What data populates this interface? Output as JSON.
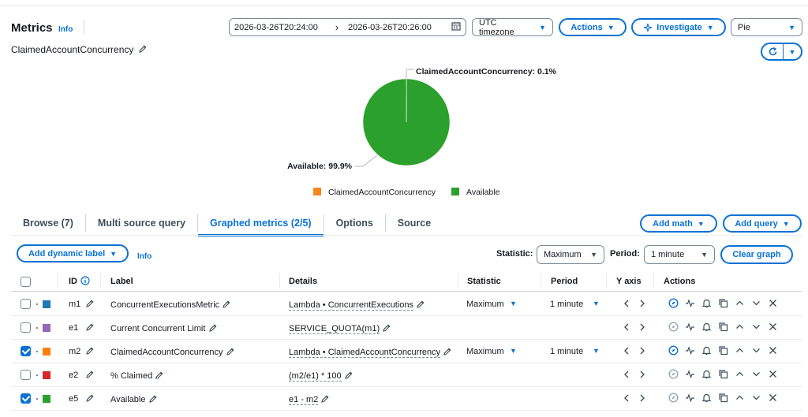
{
  "header": {
    "title": "Metrics",
    "info": "Info",
    "graph_name": "ClaimedAccountConcurrency",
    "time_start": "2026-03-26T20:24:00",
    "time_arrow": "›",
    "time_end": "2026-03-26T20:26:00",
    "timezone": "UTC timezone",
    "actions": "Actions",
    "investigate": "Investigate",
    "graph_type": "Pie"
  },
  "chart_data": {
    "type": "pie",
    "slices": [
      {
        "label": "ClaimedAccountConcurrency",
        "value": 0.1,
        "color": "#f7861e",
        "callout": "ClaimedAccountConcurrency: 0.1%"
      },
      {
        "label": "Available",
        "value": 99.9,
        "color": "#2ca02c",
        "callout": "Available: 99.9%"
      }
    ],
    "legend": [
      "ClaimedAccountConcurrency",
      "Available"
    ],
    "legend_placement": "bottom"
  },
  "tabs": [
    {
      "label": "Browse (7)",
      "active": false
    },
    {
      "label": "Multi source query",
      "active": false
    },
    {
      "label": "Graphed metrics (2/5)",
      "active": true
    },
    {
      "label": "Options",
      "active": false
    },
    {
      "label": "Source",
      "active": false
    }
  ],
  "toolbar": {
    "add_math": "Add math",
    "add_query": "Add query",
    "add_dynamic_label": "Add dynamic label",
    "info": "Info",
    "statistic_label": "Statistic:",
    "statistic_value": "Maximum",
    "period_label": "Period:",
    "period_value": "1 minute",
    "clear_graph": "Clear graph"
  },
  "table": {
    "headers": {
      "id": "ID",
      "label": "Label",
      "details": "Details",
      "statistic": "Statistic",
      "period": "Period",
      "yaxis": "Y axis",
      "actions": "Actions"
    },
    "rows": [
      {
        "checked": false,
        "color": "#1f77b4",
        "id": "m1",
        "label": "ConcurrentExecutionsMetric",
        "details": "Lambda • ConcurrentExecutions",
        "statistic": "Maximum",
        "period": "1 minute",
        "active_icons": true
      },
      {
        "checked": false,
        "color": "#9467bd",
        "id": "e1",
        "label": "Current Concurrent Limit",
        "details": "SERVICE_QUOTA(m1)",
        "statistic": "",
        "period": "",
        "active_icons": false
      },
      {
        "checked": true,
        "color": "#ff7f0e",
        "id": "m2",
        "label": "ClaimedAccountConcurrency",
        "details": "Lambda • ClaimedAccountConcurrency",
        "statistic": "Maximum",
        "period": "1 minute",
        "active_icons": true
      },
      {
        "checked": false,
        "color": "#d62728",
        "id": "e2",
        "label": "% Claimed",
        "details": "(m2/e1) * 100",
        "statistic": "",
        "period": "",
        "active_icons": false
      },
      {
        "checked": true,
        "color": "#2ca02c",
        "id": "e5",
        "label": "Available",
        "details": "e1 - m2",
        "statistic": "",
        "period": "",
        "active_icons": false
      }
    ]
  }
}
